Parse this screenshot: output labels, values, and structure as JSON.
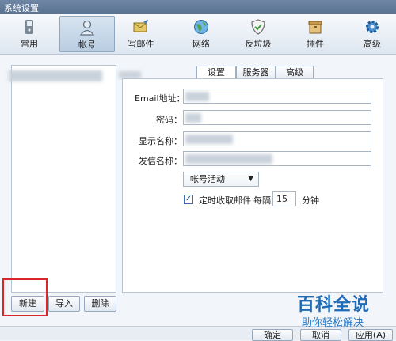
{
  "window": {
    "title": "系统设置"
  },
  "toolbar": {
    "items": [
      {
        "label": "常用",
        "icon": "phone-icon"
      },
      {
        "label": "帐号",
        "icon": "user-icon"
      },
      {
        "label": "写邮件",
        "icon": "compose-mail-icon"
      },
      {
        "label": "网络",
        "icon": "globe-icon"
      },
      {
        "label": "反垃圾",
        "icon": "shield-icon"
      },
      {
        "label": "插件",
        "icon": "plugin-box-icon"
      },
      {
        "label": "高级",
        "icon": "gear-icon"
      }
    ],
    "active_index": 1
  },
  "tabs": [
    {
      "label": "设置",
      "selected": true
    },
    {
      "label": "服务器",
      "selected": false
    },
    {
      "label": "高级",
      "selected": false
    }
  ],
  "form": {
    "email_label": "Email地址：",
    "password_label": "密码：",
    "display_name_label": "显示名称：",
    "sender_name_label": "发信名称：",
    "account_status": "帐号活动",
    "auto_receive_label": "定时收取邮件",
    "auto_receive_checked": true,
    "every_label": "每隔",
    "interval_value": "15",
    "unit_label": "分钟"
  },
  "account_buttons": {
    "new": "新建",
    "import": "导入",
    "delete": "删除"
  },
  "dialog_buttons": {
    "ok": "确定",
    "cancel": "取消",
    "apply": "应用(A)"
  },
  "watermark": {
    "line1": "百科全说",
    "line2": "助你轻松解决"
  },
  "colors": {
    "highlight_border": "#d8262a",
    "watermark": "#1f6bb8"
  }
}
